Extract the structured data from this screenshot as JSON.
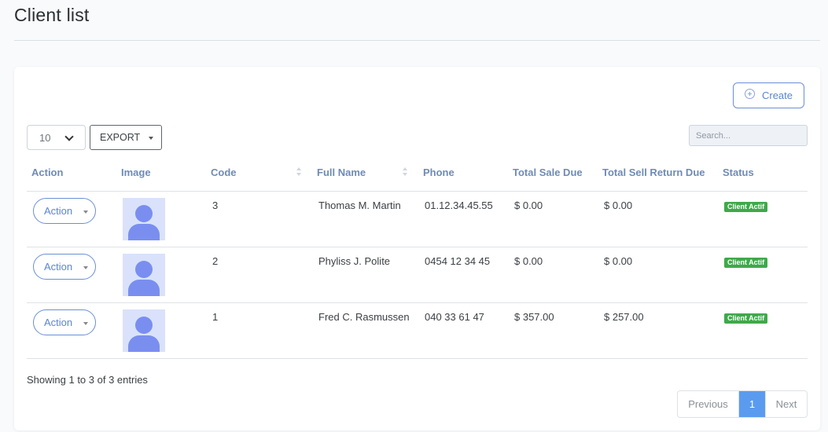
{
  "page": {
    "title": "Client list"
  },
  "toolbar": {
    "create_label": "Create",
    "per_page_value": "10",
    "export_label": "EXPORT",
    "search_placeholder": "Search..."
  },
  "table": {
    "columns": [
      "Action",
      "Image",
      "Code",
      "Full Name",
      "Phone",
      "Total Sale Due",
      "Total Sell Return Due",
      "Status"
    ],
    "rows": [
      {
        "action": "Action",
        "code": "3",
        "full_name": "Thomas M. Martin",
        "phone": "01.12.34.45.55",
        "total_sale_due": "$ 0.00",
        "total_sell_return_due": "$ 0.00",
        "status": "Client Actif"
      },
      {
        "action": "Action",
        "code": "2",
        "full_name": "Phyliss J. Polite",
        "phone": "0454 12 34 45",
        "total_sale_due": "$ 0.00",
        "total_sell_return_due": "$ 0.00",
        "status": "Client Actif"
      },
      {
        "action": "Action",
        "code": "1",
        "full_name": "Fred C. Rasmussen",
        "phone": "040 33 61 47",
        "total_sale_due": "$ 357.00",
        "total_sell_return_due": "$ 257.00",
        "status": "Client Actif"
      }
    ]
  },
  "footer": {
    "info": "Showing 1 to 3 of 3 entries"
  },
  "pagination": {
    "previous": "Previous",
    "current": "1",
    "next": "Next"
  },
  "colors": {
    "accent": "#5b85cf",
    "status_active": "#3fa94a",
    "pagination_active": "#5a9bf0",
    "avatar_bg": "#d9e2fa",
    "avatar_fg": "#7a8ef0"
  },
  "icons": {
    "create": "plus-circle-icon",
    "per_page": "chevron-down-icon",
    "dropdown": "caret-down-icon",
    "sort": "sort-icon",
    "avatar": "user-avatar-icon"
  }
}
